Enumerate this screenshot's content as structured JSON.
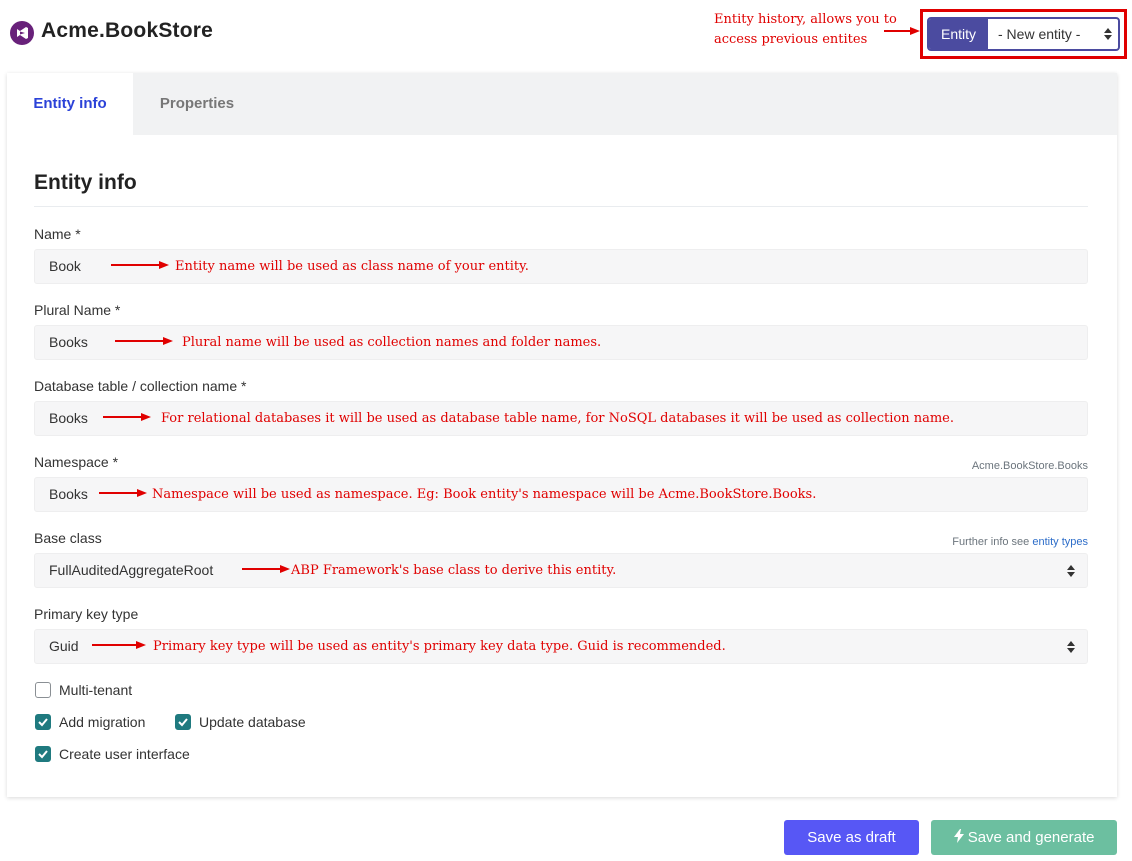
{
  "header": {
    "brand": "Acme.BookStore",
    "history_note": "Entity history, allows you to access previous entites",
    "history_button": "Entity",
    "history_select": "- New entity -"
  },
  "tabs": [
    {
      "label": "Entity info",
      "active": true
    },
    {
      "label": "Properties",
      "active": false
    }
  ],
  "form": {
    "title": "Entity info",
    "name": {
      "label": "Name *",
      "value": "Book",
      "note": "Entity name will be used as class name of your entity."
    },
    "plural_name": {
      "label": "Plural Name *",
      "value": "Books",
      "note": "Plural name will be used as collection names and folder names."
    },
    "db_table": {
      "label": "Database table / collection name *",
      "value": "Books",
      "note": "For relational databases it will be used as database table name, for NoSQL databases it will be used as collection name."
    },
    "namespace": {
      "label": "Namespace *",
      "value": "Books",
      "hint": "Acme.BookStore.Books",
      "note": "Namespace will be used as namespace. Eg: Book entity's namespace will be Acme.BookStore.Books."
    },
    "base_class": {
      "label": "Base class",
      "value": "FullAuditedAggregateRoot",
      "hint_prefix": "Further info see",
      "hint_link": "entity types",
      "note": "ABP Framework's base class to derive this entity."
    },
    "primary_key": {
      "label": "Primary key type",
      "value": "Guid",
      "note": "Primary key type will be used as entity's primary key data type. Guid is recommended."
    },
    "checkboxes": {
      "multi_tenant": {
        "label": "Multi-tenant",
        "checked": false
      },
      "add_migration": {
        "label": "Add migration",
        "checked": true
      },
      "update_database": {
        "label": "Update database",
        "checked": true
      },
      "create_ui": {
        "label": "Create user interface",
        "checked": true
      }
    }
  },
  "actions": {
    "save_draft": "Save as draft",
    "save_generate": "Save and generate"
  },
  "colors": {
    "accent": "#4b4ba0",
    "tab_active": "#2b42d8",
    "annotation": "#e00000",
    "checkbox": "#1f7a7f",
    "draft_button": "#5757f5",
    "generate_button": "#6cbfa0"
  },
  "icons": {
    "logo": "visual-studio-logo-icon",
    "select_arrows": "updown-arrows-icon",
    "bolt": "lightning-bolt-icon",
    "check": "checkmark-icon",
    "annotation_arrow": "red-arrow-icon"
  }
}
